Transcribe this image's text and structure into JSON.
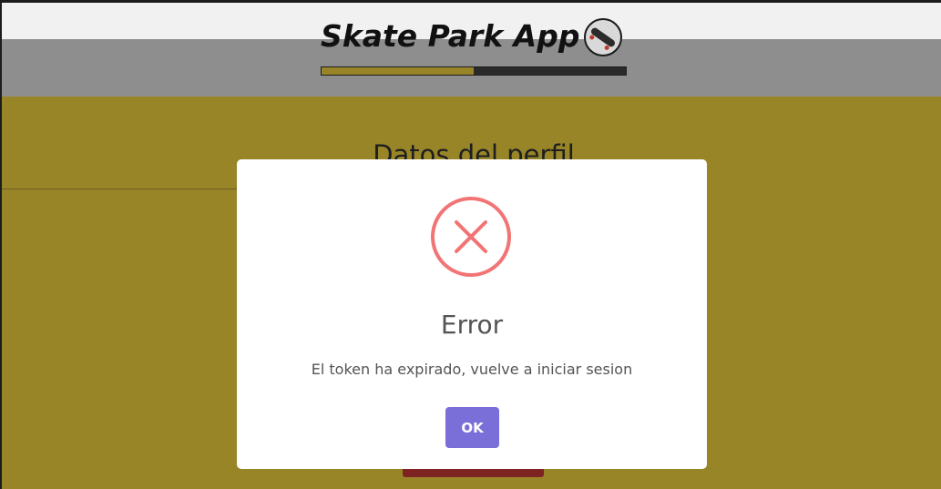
{
  "header": {
    "app_title": "Skate Park App",
    "logo_icon": "skateboard-icon",
    "progress_fraction": 0.5
  },
  "main": {
    "section_title": "Datos del perfil"
  },
  "modal": {
    "icon": "error-x-icon",
    "title": "Error",
    "message": "El token ha expirado, vuelve a iniciar sesion",
    "ok_label": "OK"
  },
  "colors": {
    "olive_dimmed": "#988528",
    "error_red": "#f27474",
    "ok_button": "#7a6ed8",
    "header_dimmed": "#8e8e8e"
  }
}
